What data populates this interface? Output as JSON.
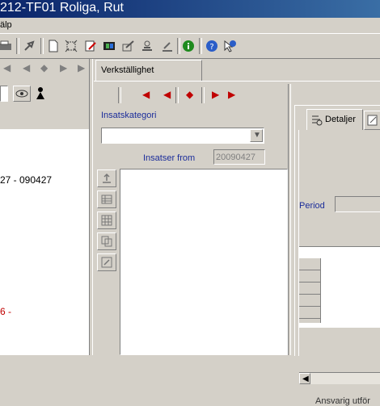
{
  "window": {
    "title": "212-TF01 Roliga, Rut"
  },
  "menu": {
    "label": "älp"
  },
  "left_panel": {
    "date_range": "27 - 090427",
    "red_fragment": "6 -"
  },
  "verk_tab": {
    "label": "Verkställighet"
  },
  "insats": {
    "kategori_label": "Insatskategori",
    "kategori_value": "",
    "from_label": "Insatser from",
    "from_value": "20090427"
  },
  "details": {
    "tab_label": "Detaljer",
    "period_label": "Period",
    "bottom_text": "Ansvarig utför"
  },
  "colors": {
    "title_start": "#0a246a",
    "title_end": "#3a6ea5",
    "label_blue": "#1a2c9a",
    "red": "#c00000"
  }
}
